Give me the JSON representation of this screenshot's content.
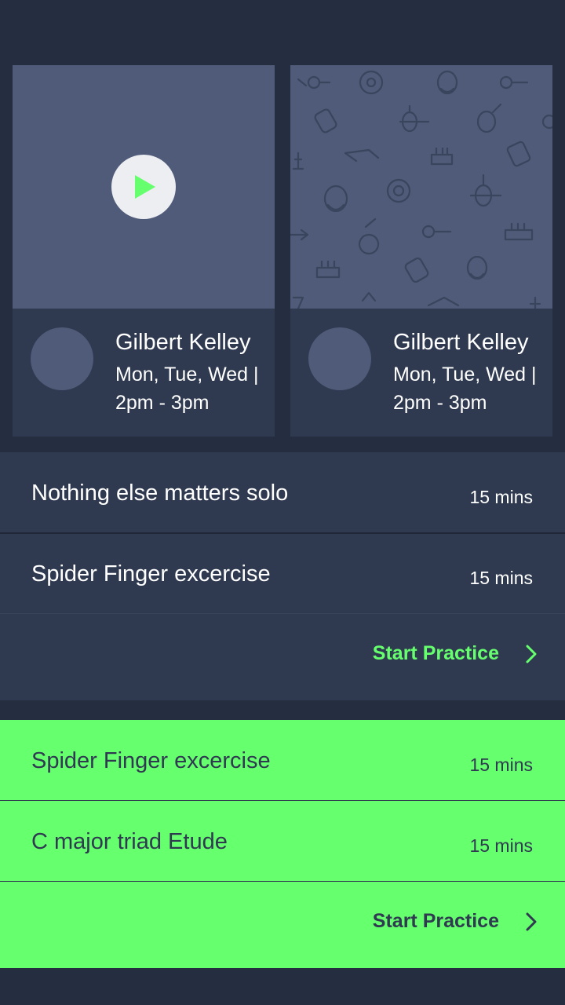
{
  "colors": {
    "background": "#252e41",
    "card": "#2f3a50",
    "media": "#4f5b78",
    "accent": "#66ff6e",
    "text_light": "#ffffff",
    "text_dark": "#2f3a50"
  },
  "cards": [
    {
      "name": "Gilbert Kelley",
      "schedule": "Mon, Tue, Wed | 2pm - 3pm",
      "media_icon": "play-icon"
    },
    {
      "name": "Gilbert Kelley",
      "schedule": "Mon, Tue, Wed | 2pm - 3pm",
      "media_icon": "instrument-pattern"
    }
  ],
  "sessions": [
    {
      "items": [
        {
          "title": "Nothing else matters solo",
          "duration": "15 mins"
        },
        {
          "title": "Spider Finger excercise",
          "duration": "15 mins"
        }
      ],
      "action": "Start Practice"
    },
    {
      "items": [
        {
          "title": "Spider Finger excercise",
          "duration": "15 mins"
        },
        {
          "title": "C major triad Etude",
          "duration": "15 mins"
        }
      ],
      "action": "Start Practice"
    }
  ]
}
